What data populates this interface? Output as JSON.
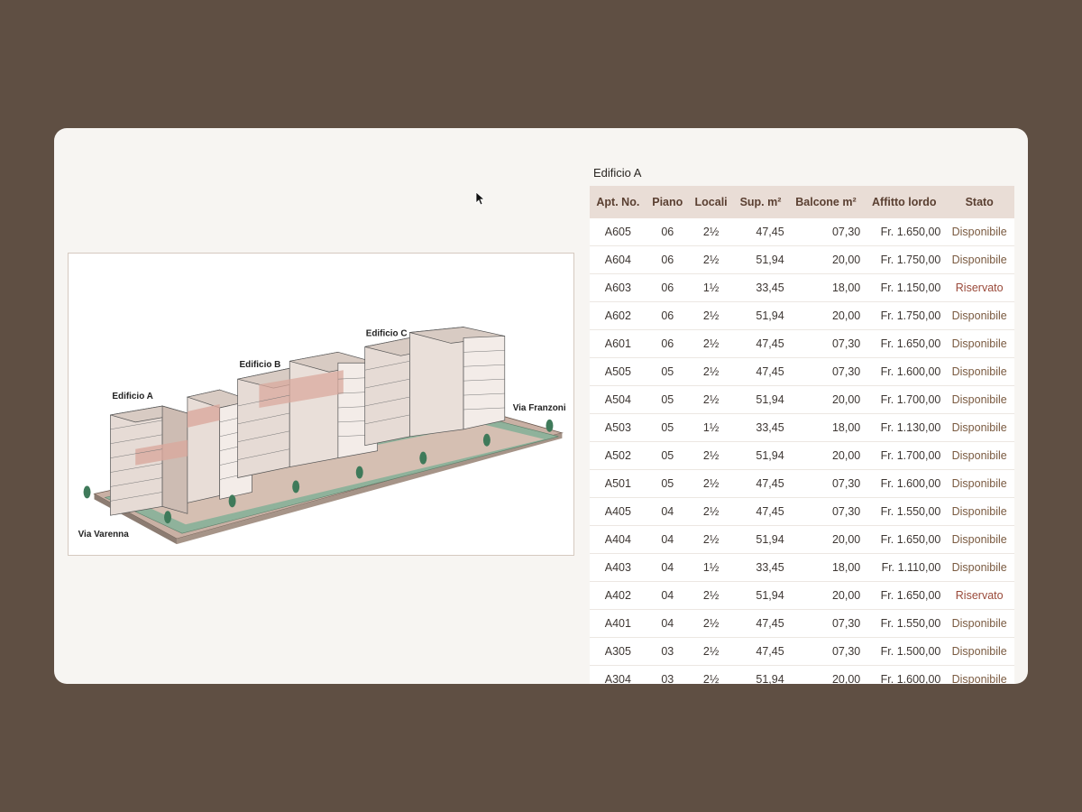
{
  "map": {
    "label_a": "Edificio A",
    "label_b": "Edificio B",
    "label_c": "Edificio C",
    "street_left": "Via Varenna",
    "street_right": "Via Franzoni"
  },
  "table": {
    "title": "Edificio A",
    "headers": [
      "Apt. No.",
      "Piano",
      "Locali",
      "Sup. m²",
      "Balcone m²",
      "Affitto lordo",
      "Stato"
    ],
    "rows": [
      [
        "A605",
        "06",
        "2½",
        "47,45",
        "07,30",
        "Fr. 1.650,00",
        "Disponibile"
      ],
      [
        "A604",
        "06",
        "2½",
        "51,94",
        "20,00",
        "Fr. 1.750,00",
        "Disponibile"
      ],
      [
        "A603",
        "06",
        "1½",
        "33,45",
        "18,00",
        "Fr. 1.150,00",
        "Riservato"
      ],
      [
        "A602",
        "06",
        "2½",
        "51,94",
        "20,00",
        "Fr. 1.750,00",
        "Disponibile"
      ],
      [
        "A601",
        "06",
        "2½",
        "47,45",
        "07,30",
        "Fr. 1.650,00",
        "Disponibile"
      ],
      [
        "A505",
        "05",
        "2½",
        "47,45",
        "07,30",
        "Fr. 1.600,00",
        "Disponibile"
      ],
      [
        "A504",
        "05",
        "2½",
        "51,94",
        "20,00",
        "Fr. 1.700,00",
        "Disponibile"
      ],
      [
        "A503",
        "05",
        "1½",
        "33,45",
        "18,00",
        "Fr. 1.130,00",
        "Disponibile"
      ],
      [
        "A502",
        "05",
        "2½",
        "51,94",
        "20,00",
        "Fr. 1.700,00",
        "Disponibile"
      ],
      [
        "A501",
        "05",
        "2½",
        "47,45",
        "07,30",
        "Fr. 1.600,00",
        "Disponibile"
      ],
      [
        "A405",
        "04",
        "2½",
        "47,45",
        "07,30",
        "Fr. 1.550,00",
        "Disponibile"
      ],
      [
        "A404",
        "04",
        "2½",
        "51,94",
        "20,00",
        "Fr. 1.650,00",
        "Disponibile"
      ],
      [
        "A403",
        "04",
        "1½",
        "33,45",
        "18,00",
        "Fr. 1.110,00",
        "Disponibile"
      ],
      [
        "A402",
        "04",
        "2½",
        "51,94",
        "20,00",
        "Fr. 1.650,00",
        "Riservato"
      ],
      [
        "A401",
        "04",
        "2½",
        "47,45",
        "07,30",
        "Fr. 1.550,00",
        "Disponibile"
      ],
      [
        "A305",
        "03",
        "2½",
        "47,45",
        "07,30",
        "Fr. 1.500,00",
        "Disponibile"
      ],
      [
        "A304",
        "03",
        "2½",
        "51,94",
        "20,00",
        "Fr. 1.600,00",
        "Disponibile"
      ]
    ]
  }
}
